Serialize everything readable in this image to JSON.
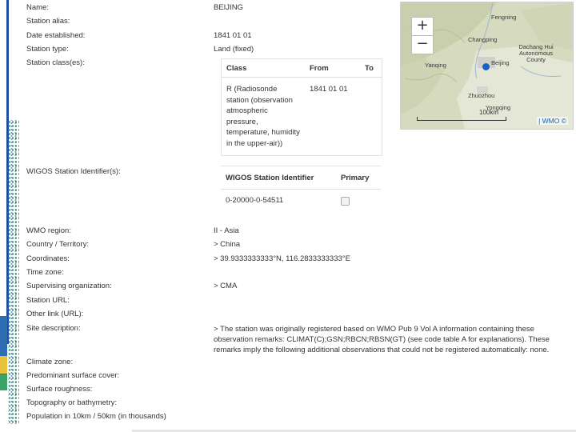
{
  "station": {
    "fields": [
      {
        "label": "Name:",
        "value": "BEIJING"
      },
      {
        "label": "Station alias:",
        "value": ""
      },
      {
        "label": "Date established:",
        "value": "1841 01 01"
      },
      {
        "label": "Station type:",
        "value": "Land (fixed)"
      },
      {
        "label": "Station class(es):",
        "value": ""
      }
    ],
    "class_table": {
      "headers": [
        "Class",
        "From",
        "To"
      ],
      "row": {
        "class_lines": [
          "R (Radiosonde",
          "station (observation",
          "atmospheric",
          "pressure,",
          "temperature, humidity",
          "in the upper-air))"
        ],
        "from": "1841 01 01",
        "to": ""
      }
    },
    "wigos": {
      "label": "WIGOS Station Identifier(s):",
      "headers": [
        "WIGOS Station Identifier",
        "Primary"
      ],
      "row": {
        "id": "0-20000-0-54511",
        "primary": false
      }
    },
    "fields2": [
      {
        "label": "WMO region:",
        "value": "II - Asia"
      },
      {
        "label": "Country / Territory:",
        "value": "> China"
      },
      {
        "label": "Coordinates:",
        "value": "> 39.9333333333°N, 116.2833333333°E"
      },
      {
        "label": "Time zone:",
        "value": ""
      },
      {
        "label": "Supervising organization:",
        "value": "> CMA"
      },
      {
        "label": "Station URL:",
        "value": ""
      },
      {
        "label": "Other link (URL):",
        "value": ""
      },
      {
        "label": "Site description:",
        "value": "> The station was originally registered based on WMO Pub 9 Vol A information containing these observation remarks: CLIMAT(C);GSN;RBCN;RBSN(GT) (see code table A for explanations). These remarks imply the following additional observations that could not be registered automatically: none."
      }
    ],
    "fields3": [
      {
        "label": "Climate zone:"
      },
      {
        "label": "Predominant surface cover:"
      },
      {
        "label": "Surface roughness:"
      },
      {
        "label": "Topography or bathymetry:"
      },
      {
        "label": "Population in 10km / 50km (in thousands)"
      }
    ]
  },
  "map": {
    "zoom_in": "+",
    "zoom_out": "−",
    "places": [
      "Fengning",
      "Changping",
      "Dachang Hui Autonomous County",
      "Yanqing",
      "Zhuozhou",
      "Yongqing",
      "Beijing"
    ],
    "scale": "100km",
    "copyright": "| WMO ©",
    "marker_color": "#1565c0"
  }
}
